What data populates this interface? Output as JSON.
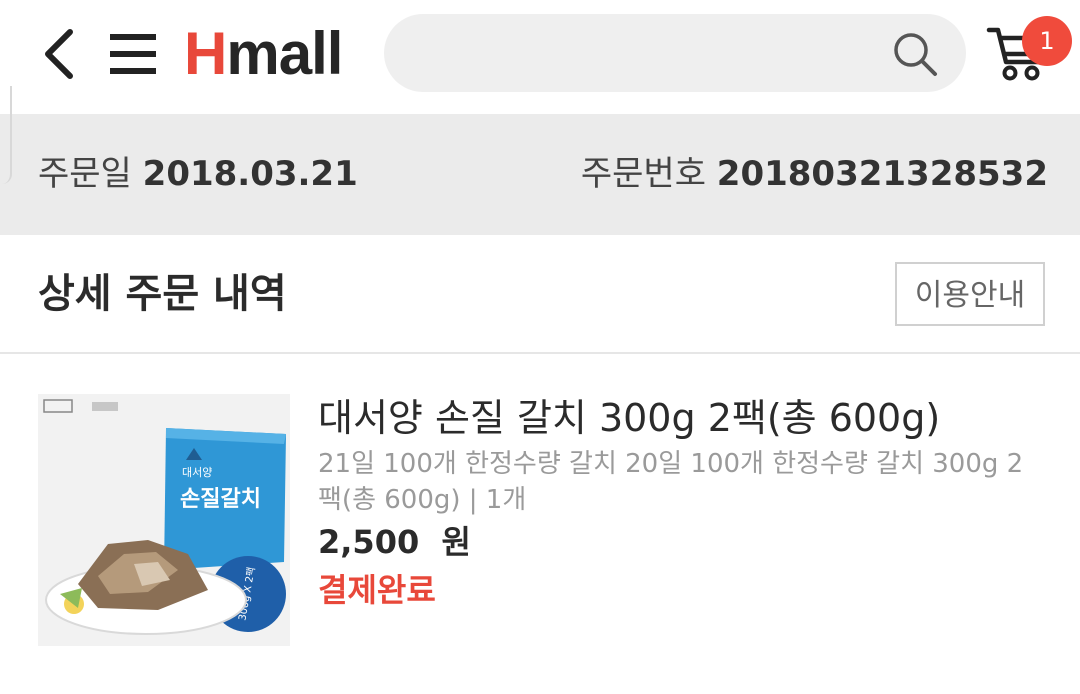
{
  "header": {
    "logo_h": "H",
    "logo_rest": "mall",
    "cart_count": "1",
    "icons": {
      "back": "chevron-left-icon",
      "menu": "hamburger-icon",
      "search": "search-icon",
      "cart": "cart-icon"
    }
  },
  "order": {
    "date_label": "주문일",
    "date_value": "2018.03.21",
    "number_label": "주문번호",
    "number_value": "20180321328532"
  },
  "section": {
    "title": "상세 주문 내역",
    "guide_button": "이용안내"
  },
  "product": {
    "name": "대서양 손질 갈치 300g 2팩(총 600g)",
    "option": "21일 100개 한정수량 갈치 20일 100개 한정수량 갈치 300g 2팩(총 600g) | 1개",
    "price": "2,500  원",
    "status": "결제완료",
    "image_text": {
      "brand_line": "대서양",
      "product_line": "손질갈치",
      "badge": "300g X 2팩"
    }
  },
  "colors": {
    "brand_red": "#e8483a",
    "status_red": "#e8483a",
    "badge_red": "#f04b3c",
    "order_bar_bg": "#ebebeb",
    "package_blue": "#2f97d6"
  }
}
